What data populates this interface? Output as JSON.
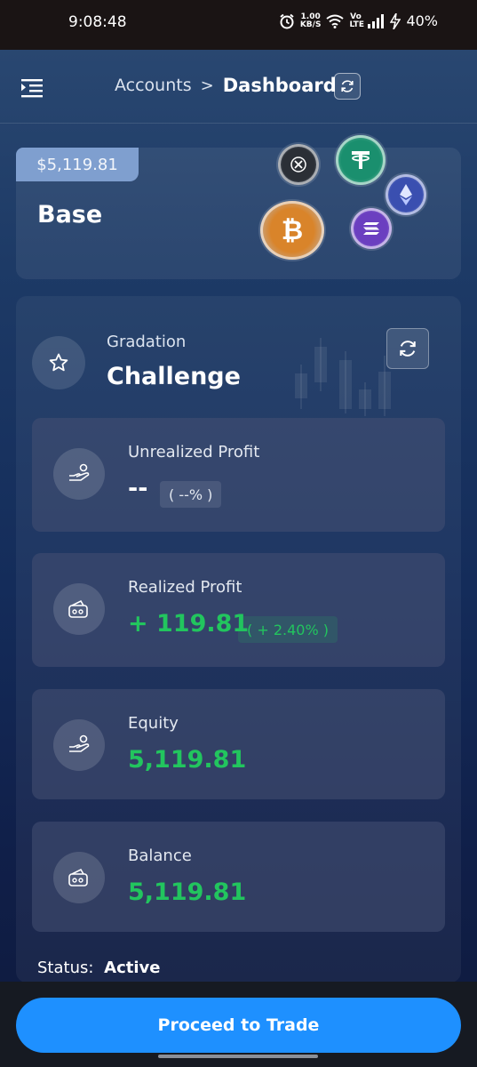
{
  "status_bar": {
    "time": "9:08:48",
    "net_speed_value": "1.00",
    "net_speed_unit": "KB/S",
    "volte": "Vo LTE",
    "battery": "40%"
  },
  "header": {
    "breadcrumb_parent": "Accounts",
    "breadcrumb_sep": ">",
    "breadcrumb_current": "Dashboard"
  },
  "account": {
    "balance_badge": "$5,119.81",
    "name": "Base"
  },
  "gradation": {
    "label": "Gradation",
    "title": "Challenge"
  },
  "metrics": {
    "unrealized": {
      "label": "Unrealized Profit",
      "value": "--",
      "badge": "( --% )"
    },
    "realized": {
      "label": "Realized Profit",
      "value": "+ 119.81",
      "badge": "( + 2.40% )"
    },
    "equity": {
      "label": "Equity",
      "value": "5,119.81"
    },
    "balance": {
      "label": "Balance",
      "value": "5,119.81"
    }
  },
  "status": {
    "label": "Status:",
    "value": "Active"
  },
  "cta": {
    "label": "Proceed to Trade"
  },
  "colors": {
    "accent": "#1e90ff",
    "positive": "#22c55e",
    "badge": "#7f9fcf"
  }
}
